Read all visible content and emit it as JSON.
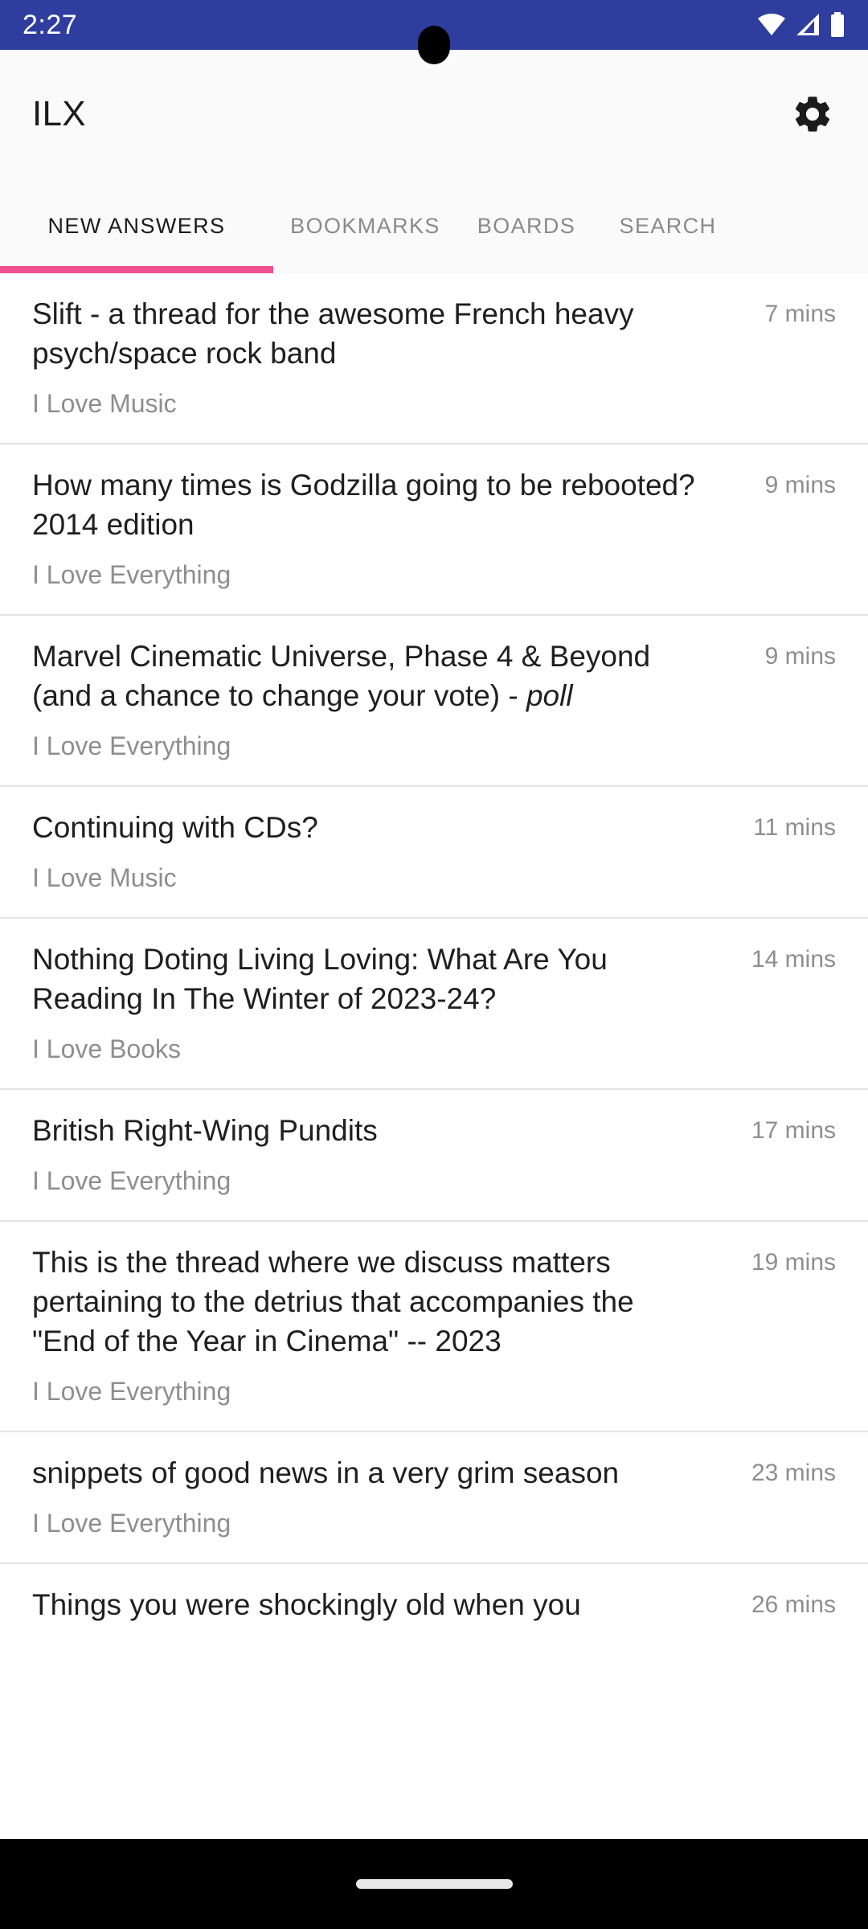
{
  "status_bar": {
    "time": "2:27",
    "background_color": "#2f3d9e",
    "icons": [
      "wifi-icon",
      "cell-signal-icon",
      "battery-icon"
    ]
  },
  "app_bar": {
    "title": "ILX",
    "settings_icon": "gear-icon"
  },
  "tabs": {
    "active_index": 0,
    "accent_color": "#ef5091",
    "items": [
      {
        "label": "NEW ANSWERS"
      },
      {
        "label": "BOOKMARKS"
      },
      {
        "label": "BOARDS"
      },
      {
        "label": "SEARCH"
      }
    ]
  },
  "threads": [
    {
      "title": "Slift - a thread for the awesome French heavy psych/space rock band",
      "title_italic_suffix": "",
      "board": "I Love Music",
      "time": "7 mins"
    },
    {
      "title": "How many times is Godzilla going to be rebooted? 2014 edition",
      "title_italic_suffix": "",
      "board": "I Love Everything",
      "time": "9 mins"
    },
    {
      "title": "Marvel Cinematic Universe, Phase 4 & Beyond (and a chance to change your vote) - ",
      "title_italic_suffix": "poll",
      "board": "I Love Everything",
      "time": "9 mins"
    },
    {
      "title": "Continuing with CDs?",
      "title_italic_suffix": "",
      "board": "I Love Music",
      "time": "11 mins"
    },
    {
      "title": "Nothing Doting Living Loving: What Are You Reading In The Winter of 2023-24?",
      "title_italic_suffix": "",
      "board": "I Love Books",
      "time": "14 mins"
    },
    {
      "title": "British Right-Wing Pundits",
      "title_italic_suffix": "",
      "board": "I Love Everything",
      "time": "17 mins"
    },
    {
      "title": "This is the thread where we discuss matters pertaining to the detrius that accompanies the \"End of the Year in Cinema\" -- 2023",
      "title_italic_suffix": "",
      "board": "I Love Everything",
      "time": "19 mins"
    },
    {
      "title": "snippets of good news in a very grim season",
      "title_italic_suffix": "",
      "board": "I Love Everything",
      "time": "23 mins"
    },
    {
      "title": "Things you were shockingly old when you",
      "title_italic_suffix": "",
      "board": "",
      "time": "26 mins"
    }
  ],
  "nav_bar": {
    "home_indicator": "home-pill"
  }
}
